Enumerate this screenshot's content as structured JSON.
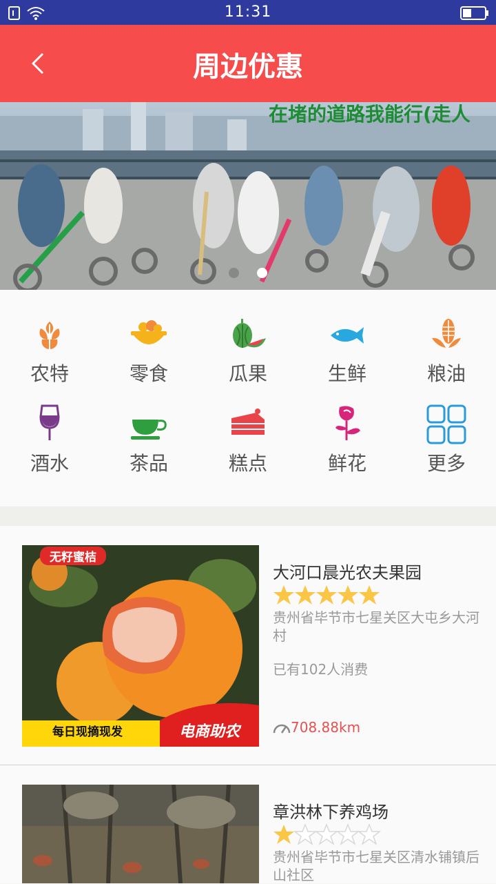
{
  "status_bar": {
    "time": "11:31"
  },
  "header": {
    "title": "周边优惠"
  },
  "banner": {
    "slogan": "在堵的道路我能行(走人",
    "dots": 2,
    "active_dot": 2
  },
  "categories": [
    {
      "label": "农特",
      "icon": "wheat-icon",
      "color": "#f08a3c"
    },
    {
      "label": "零食",
      "icon": "snack-bowl-icon",
      "color": "#f5b21a"
    },
    {
      "label": "瓜果",
      "icon": "watermelon-icon",
      "color": "#4aa24a"
    },
    {
      "label": "生鲜",
      "icon": "fish-icon",
      "color": "#29a8e0"
    },
    {
      "label": "粮油",
      "icon": "corn-icon",
      "color": "#f08a3c"
    },
    {
      "label": "酒水",
      "icon": "wine-glass-icon",
      "color": "#7a3a8a"
    },
    {
      "label": "茶品",
      "icon": "teacup-icon",
      "color": "#2e9e3e"
    },
    {
      "label": "糕点",
      "icon": "cake-icon",
      "color": "#e8444a"
    },
    {
      "label": "鲜花",
      "icon": "flower-icon",
      "color": "#d8247a"
    },
    {
      "label": "更多",
      "icon": "grid-icon",
      "color": "#2a9ad8"
    }
  ],
  "stores": [
    {
      "name": "大河口晨光农夫果园",
      "rating": 5,
      "address": "贵州省毕节市七星关区大屯乡大河村",
      "sold": "已有102人消费",
      "distance": "708.88km",
      "image_tag": "无籽蜜桔",
      "image_caption": "每日现摘现发",
      "image_caption2": "电商助农"
    },
    {
      "name": "章洪林下养鸡场",
      "rating": 1,
      "address": "贵州省毕节市七星关区清水铺镇后山社区"
    }
  ],
  "colors": {
    "header": "#f64c4c",
    "status": "#2f3a9e",
    "star": "#fbc546",
    "distance": "#e55050"
  }
}
